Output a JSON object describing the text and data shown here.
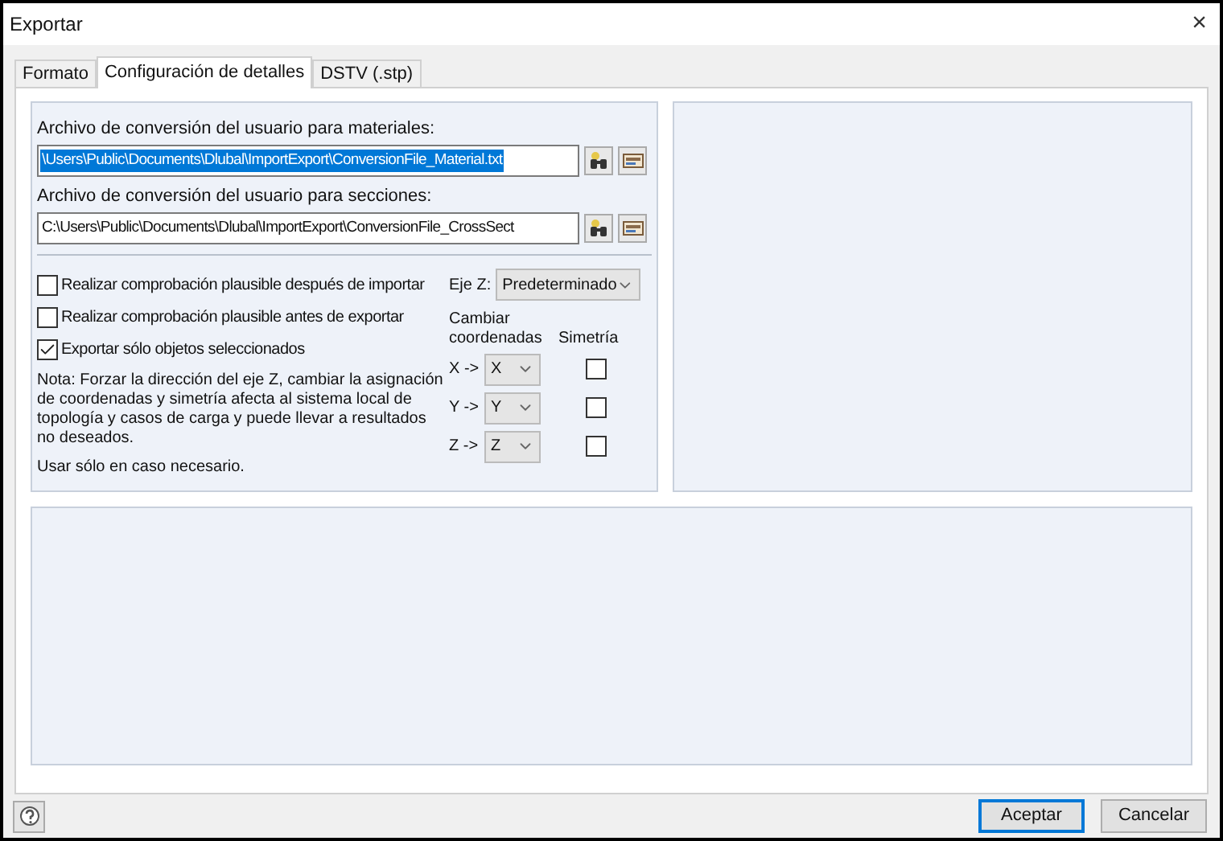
{
  "window": {
    "title": "Exportar",
    "close": "×"
  },
  "tabs": [
    {
      "label": "Formato",
      "selected": false
    },
    {
      "label": "Configuración de detalles",
      "selected": true
    },
    {
      "label": "DSTV (.stp)",
      "selected": false
    }
  ],
  "materials": {
    "label": "Archivo de conversión del usuario para materiales:",
    "value": "\\Users\\Public\\Documents\\Dlubal\\ImportExport\\ConversionFile_Material.txt",
    "highlighted": true
  },
  "sections": {
    "label": "Archivo de conversión del usuario para secciones:",
    "value": "C:\\Users\\Public\\Documents\\Dlubal\\ImportExport\\ConversionFile_CrossSect",
    "highlighted": false
  },
  "options": [
    {
      "label": "Realizar comprobación plausible después de importar",
      "checked": false
    },
    {
      "label": "Realizar comprobación plausible antes de exportar",
      "checked": false
    },
    {
      "label": "Exportar sólo objetos seleccionados",
      "checked": true
    }
  ],
  "note": "Nota: Forzar la dirección del eje Z, cambiar la asignación de coordenadas y simetría afecta al sistema local de topología y casos de carga y puede llevar a resultados no deseados.",
  "note2": "Usar sólo en caso necesario.",
  "z_axis": {
    "label": "Eje Z:",
    "value": "Predeterminado"
  },
  "coord_header": "Cambiar coordenadas",
  "symmetry_header": "Simetría",
  "axes": [
    {
      "label": "X ->",
      "value": "X",
      "symmetry": false
    },
    {
      "label": "Y ->",
      "value": "Y",
      "symmetry": false
    },
    {
      "label": "Z ->",
      "value": "Z",
      "symmetry": false
    }
  ],
  "buttons": [
    {
      "label": "Aceptar",
      "default": true
    },
    {
      "label": "Cancelar",
      "default": false
    }
  ]
}
